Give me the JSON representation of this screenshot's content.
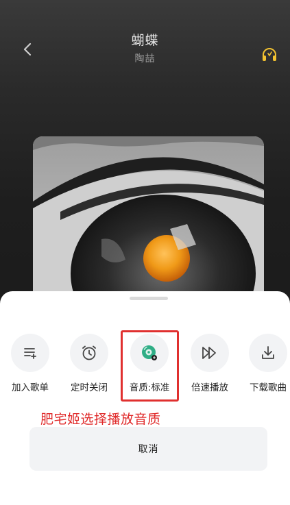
{
  "header": {
    "title": "蝴蝶",
    "artist": "陶喆",
    "back_icon": "chevron-left-icon",
    "listen_icon": "headphones-icon"
  },
  "sheet": {
    "actions": [
      {
        "label": "加入歌单",
        "icon": "playlist-add-icon"
      },
      {
        "label": "定时关闭",
        "icon": "alarm-clock-icon"
      },
      {
        "label": "音质:标准",
        "icon": "audio-quality-icon"
      },
      {
        "label": "倍速播放",
        "icon": "speed-forward-icon"
      },
      {
        "label": "下载歌曲",
        "icon": "download-icon"
      }
    ],
    "annotation": "肥宅姬选择播放音质",
    "cancel_label": "取消"
  },
  "colors": {
    "accent_green": "#2fae86",
    "annotation_red": "#e02a2a",
    "headphone_yellow": "#f2c230"
  }
}
